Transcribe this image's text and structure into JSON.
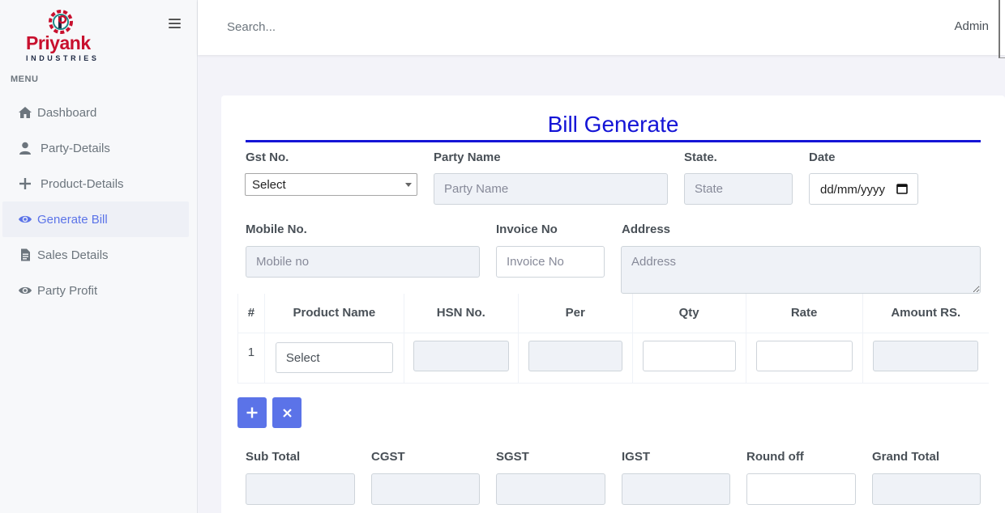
{
  "brand": {
    "name": "Priyank",
    "subtitle": "INDUSTRIES"
  },
  "sidebar": {
    "menu_title": "MENU",
    "items": [
      {
        "label": "Dashboard",
        "icon": "home-icon"
      },
      {
        "label": "Party-Details",
        "icon": "user-icon"
      },
      {
        "label": "Product-Details",
        "icon": "plus-icon"
      },
      {
        "label": "Generate Bill",
        "icon": "eye-icon",
        "active": true
      },
      {
        "label": "Sales Details",
        "icon": "document-icon"
      },
      {
        "label": "Party Profit",
        "icon": "eye-icon"
      }
    ]
  },
  "topbar": {
    "search_placeholder": "Search...",
    "user": "Admin"
  },
  "form": {
    "title": "Bill Generate",
    "gst": {
      "label": "Gst No.",
      "value": "Select"
    },
    "party": {
      "label": "Party Name",
      "placeholder": "Party Name"
    },
    "state": {
      "label": "State.",
      "placeholder": "State"
    },
    "date": {
      "label": "Date",
      "value": "dd/mm/yyyy"
    },
    "mobile": {
      "label": "Mobile No.",
      "placeholder": "Mobile no"
    },
    "invoice": {
      "label": "Invoice No",
      "placeholder": "Invoice No"
    },
    "address": {
      "label": "Address",
      "placeholder": "Address"
    }
  },
  "table": {
    "headers": [
      "#",
      "Product Name",
      "HSN No.",
      "Per",
      "Qty",
      "Rate",
      "Amount RS."
    ],
    "rows": [
      {
        "index": "1",
        "product": "Select"
      }
    ]
  },
  "buttons": {
    "add": "+",
    "remove": "×"
  },
  "totals": {
    "sub_total": "Sub Total",
    "cgst": "CGST",
    "sgst": "SGST",
    "igst": "IGST",
    "round_off": "Round off",
    "grand_total": "Grand Total"
  },
  "colors": {
    "accent": "#5b73e8",
    "title": "#1414d6",
    "brand": "#c8102e"
  }
}
